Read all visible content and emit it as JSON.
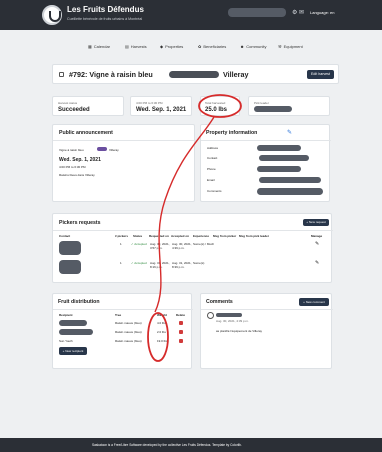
{
  "header": {
    "brand": "Les Fruits Défendus",
    "tagline": "Cueillette bénévole de fruits urbains à Montréal",
    "language": "Language: en"
  },
  "nav": {
    "items": [
      "Calendar",
      "Harvests",
      "Properties",
      "Beneficiaries",
      "Community",
      "Equipment"
    ]
  },
  "harvest": {
    "title": "#792: Vigne à raisin bleu",
    "title_suffix": "Villeray",
    "edit": "Edit harvest",
    "status_label": "Harvest status",
    "status_value": "Succeeded",
    "date_label": "4:00 PM to 6:30 PM",
    "date_value": "Wed. Sep. 1, 2021",
    "total_label": "Total harvested",
    "total_value": "25.0 lbs",
    "pick_leader_label": "Pick leader"
  },
  "announcement": {
    "heading": "Public announcement",
    "line1": "Vigne à raisin bleu",
    "line1b": "Villeray",
    "date": "Wed. Sep. 1, 2021",
    "time": "4:00 PM to 6:30 PM",
    "note": "Raisins bleus dans Villeray"
  },
  "property": {
    "heading": "Property information",
    "fields": [
      "Address",
      "Contact",
      "Phone",
      "Email",
      "Comments"
    ]
  },
  "pickers": {
    "heading": "Pickers requests",
    "new": "+ New request",
    "columns": [
      "Contact",
      "# pickers",
      "Status",
      "Requested on",
      "Accepted on",
      "Experience",
      "Msg from picker",
      "Msg from pick leader",
      "Manage"
    ],
    "rows": [
      {
        "n": "1",
        "status": "Accepted",
        "req": "Aug. 30, 2021, 3:57 p.m.",
        "acc": "Aug. 30, 2021, 4:39 p.m.",
        "exp": "Some(s) / Much"
      },
      {
        "n": "1",
        "status": "Accepted",
        "req": "Aug. 31, 2021, 8:16 p.m.",
        "acc": "Aug. 31, 2021, 8:39 p.m.",
        "exp": "Some(s)"
      }
    ]
  },
  "distribution": {
    "heading": "Fruit distribution",
    "columns": [
      "Recipient",
      "Tree",
      "Weight",
      "Delete"
    ],
    "rows": [
      {
        "recipient": "",
        "tree": "Raisin mauve (bleu)",
        "weight": "4.0 lbs"
      },
      {
        "recipient": "",
        "tree": "Raisin mauve (bleu)",
        "weight": "2.0 lbs"
      },
      {
        "recipient": "Sun Youth",
        "tree": "Raisin mauve (bleu)",
        "weight": "19.0 lbs"
      }
    ],
    "new": "+ New recipient"
  },
  "comments": {
    "heading": "Comments",
    "new": "+ New comment",
    "date": "Aug. 30, 2021, 4:39 p.m.",
    "text": "as planifié l'équipement de Villeray"
  },
  "footer": {
    "text": "Saskatoon is a Free/Libre Software developed by the collective Les Fruits Défendus. Template by Colorlib."
  }
}
